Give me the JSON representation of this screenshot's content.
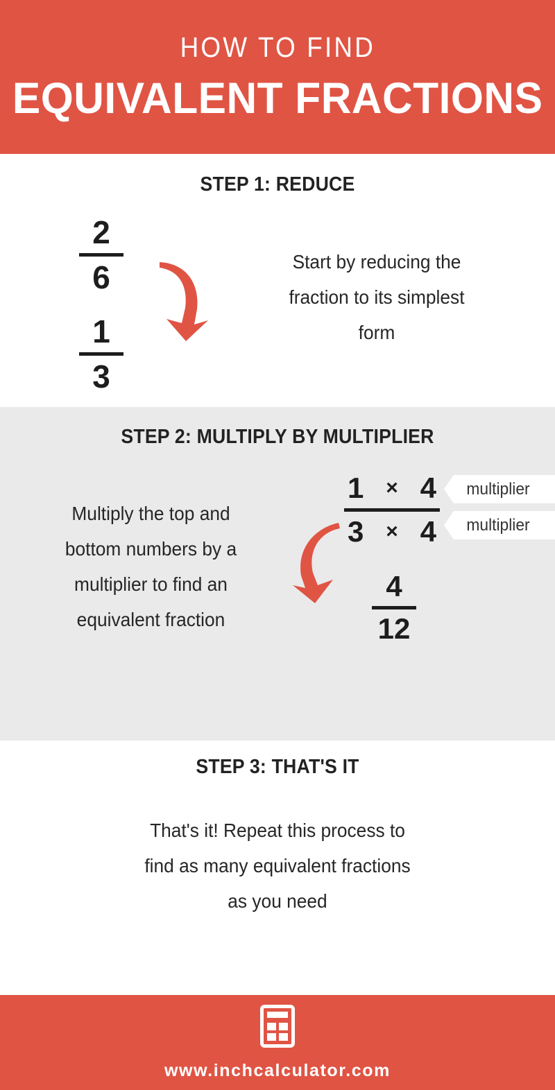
{
  "header": {
    "kicker": "HOW TO FIND",
    "title": "EQUIVALENT FRACTIONS",
    "background_color": "#e05444",
    "text_color": "#ffffff"
  },
  "steps": [
    {
      "heading": "STEP 1: REDUCE",
      "body": "Start by reducing the fraction to its simplest form",
      "background_color": "#ffffff",
      "fraction_from": {
        "numerator": "2",
        "denominator": "6"
      },
      "fraction_to": {
        "numerator": "1",
        "denominator": "3"
      },
      "arrow": "curved-down-arrow-icon"
    },
    {
      "heading": "STEP 2: MULTIPLY BY MULTIPLIER",
      "body": "Multiply the top and bottom numbers by a multiplier to find an equivalent fraction",
      "background_color": "#eaeaea",
      "expression": {
        "numerator_left": "1",
        "numerator_operator": "×",
        "numerator_right": "4",
        "denominator_left": "3",
        "denominator_operator": "×",
        "denominator_right": "4"
      },
      "callouts": [
        {
          "label": "multiplier"
        },
        {
          "label": "multiplier"
        }
      ],
      "result": {
        "numerator": "4",
        "denominator": "12"
      },
      "arrow": "curved-down-arrow-icon"
    },
    {
      "heading": "STEP 3: THAT'S IT",
      "body": "That's it! Repeat this process to find as many equivalent fractions as you need",
      "background_color": "#ffffff"
    }
  ],
  "footer": {
    "logo": "calculator-icon",
    "url": "www.inchcalculator.com",
    "background_color": "#e05444",
    "text_color": "#ffffff"
  },
  "colors": {
    "accent_red": "#e05444",
    "section_gray": "#eaeaea",
    "ink": "#222222"
  }
}
